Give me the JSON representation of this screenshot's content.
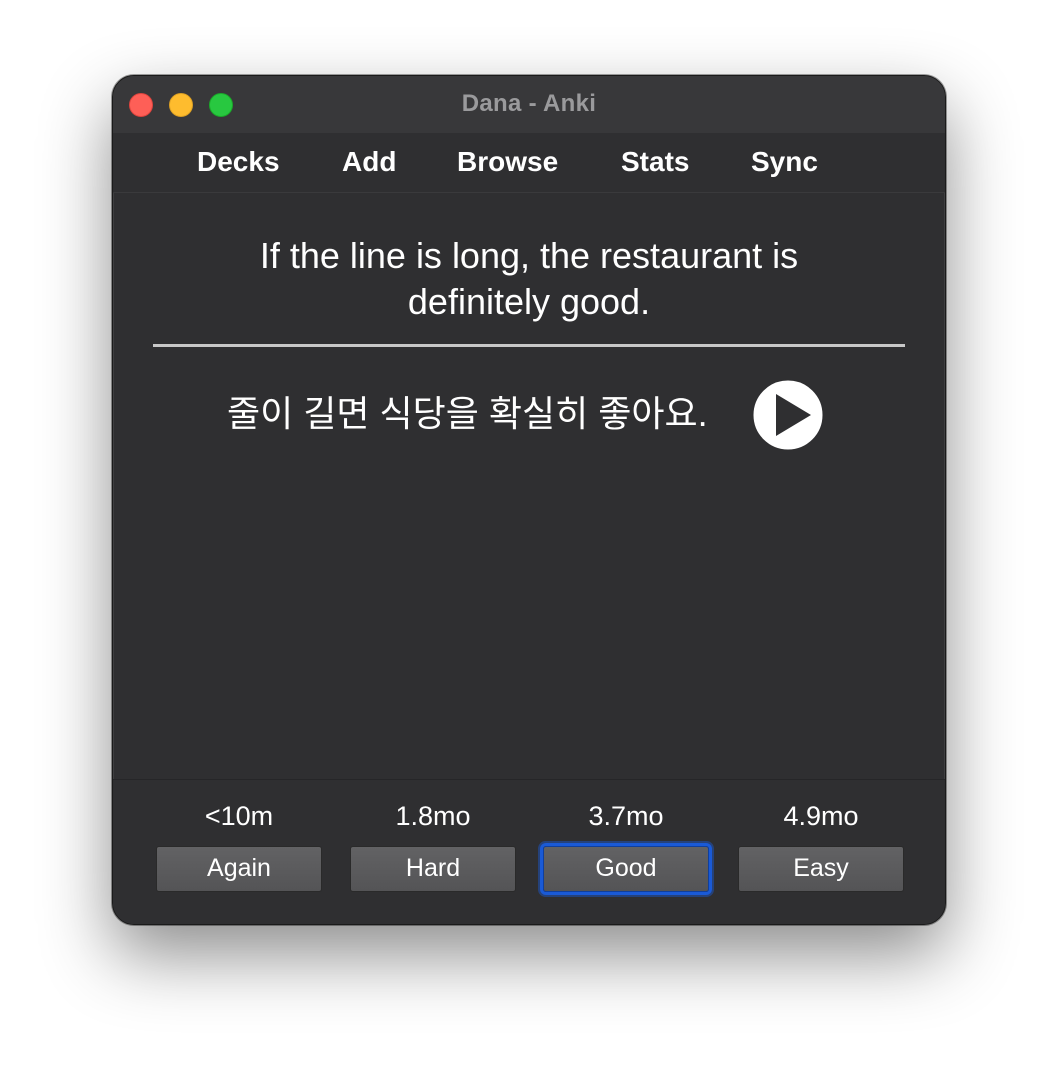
{
  "window": {
    "title": "Dana - Anki"
  },
  "toolbar": {
    "items": [
      {
        "label": "Decks"
      },
      {
        "label": "Add"
      },
      {
        "label": "Browse"
      },
      {
        "label": "Stats"
      },
      {
        "label": "Sync"
      }
    ]
  },
  "card": {
    "front_line1": "If the line is long, the restaurant is",
    "front_line2": "definitely good.",
    "back": "줄이 길면 식당을 확실히 좋아요."
  },
  "answer_buttons": [
    {
      "interval": "<10m",
      "label": "Again"
    },
    {
      "interval": "1.8mo",
      "label": "Hard"
    },
    {
      "interval": "3.7mo",
      "label": "Good",
      "focused": true
    },
    {
      "interval": "4.9mo",
      "label": "Easy"
    }
  ],
  "colors": {
    "focus_ring": "#1a5ad6",
    "background": "#2f2f31"
  }
}
